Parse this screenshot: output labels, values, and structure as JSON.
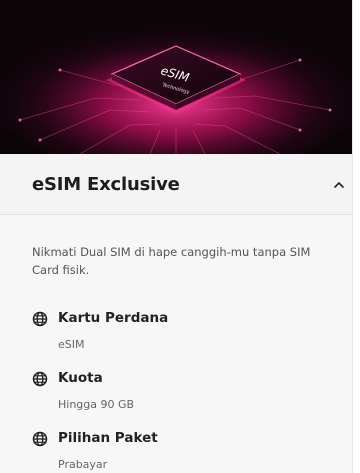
{
  "hero": {
    "chip_text": "eSIM",
    "chip_subtext": "Technology"
  },
  "card": {
    "title": "eSIM Exclusive",
    "description": "Nikmati Dual SIM di hape canggih-mu tanpa SIM Card fisik."
  },
  "features": [
    {
      "icon": "globe-icon",
      "label": "Kartu Perdana",
      "value": "eSIM"
    },
    {
      "icon": "globe-icon",
      "label": "Kuota",
      "value": "Hingga 90 GB"
    },
    {
      "icon": "globe-icon",
      "label": "Pilihan Paket",
      "value": "Prabayar"
    }
  ],
  "colors": {
    "accent": "#e8106e",
    "title": "#1d1d1d",
    "text": "#555555"
  }
}
